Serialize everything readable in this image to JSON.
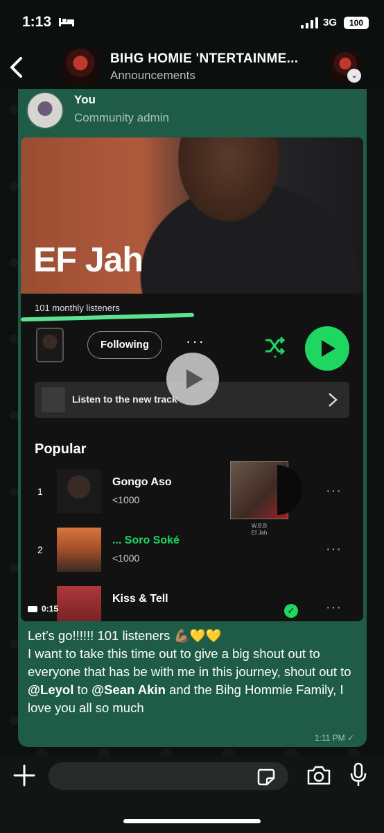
{
  "status_bar": {
    "time": "1:13",
    "network": "3G",
    "battery": "100"
  },
  "header": {
    "title": "BIHG HOMIE 'NTERTAINME...",
    "subtitle": "Announcements"
  },
  "message": {
    "sender": "You",
    "role": "Community admin",
    "video": {
      "artist": "EF Jah",
      "listeners": "101 monthly listeners",
      "following_label": "Following",
      "promo_text": "Listen to the new track",
      "section_title": "Popular",
      "tracks": [
        {
          "num": "1",
          "title": "Gongo Aso",
          "plays": "<1000"
        },
        {
          "num": "2",
          "title": "... Soro Soké",
          "plays": "<1000"
        },
        {
          "num": "",
          "title": "Kiss & Tell",
          "plays": ""
        }
      ],
      "album_caption_1": "W.B.B",
      "album_caption_2": "Ef Jah",
      "duration": "0:15"
    },
    "caption_line1": "Let’s go!!!!!! 101 listeners 💪🏽💛💛",
    "caption_part1": "I want to take this time out to give a big shout out to everyone that has be with me in this journey, shout out to ",
    "mention1": "@Leyol",
    "caption_part2": " to ",
    "mention2": "@Sean Akin",
    "caption_part3": " and the Bihg Hommie Family, I love you all so much",
    "time": "1:11 PM ✓"
  },
  "input": {
    "placeholder": ""
  },
  "colors": {
    "bubble": "#1f5c48",
    "spotify_green": "#1ed760"
  }
}
